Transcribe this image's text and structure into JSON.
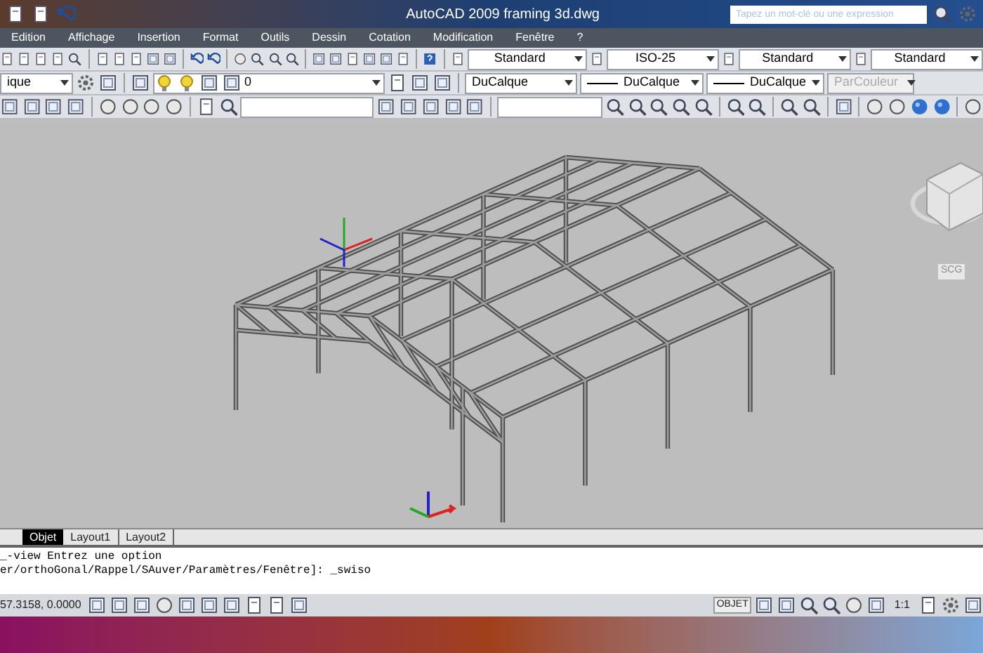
{
  "window": {
    "title": "AutoCAD 2009 framing 3d.dwg",
    "search": {
      "placeholder": "Tapez un mot-clé ou une expression"
    }
  },
  "menu": [
    "Edition",
    "Affichage",
    "Insertion",
    "Format",
    "Outils",
    "Dessin",
    "Cotation",
    "Modification",
    "Fenêtre",
    "?"
  ],
  "style_toolbar": {
    "dropdowns": [
      "Standard",
      "ISO-25",
      "Standard",
      "Standard"
    ]
  },
  "layers_toolbar": {
    "layer_state": "ique",
    "current_layer": "0"
  },
  "properties_toolbar": {
    "color_dropdown": "DuCalque",
    "linetype": "DuCalque",
    "lineweight": "DuCalque",
    "plot_style": {
      "value": "ParCouleur",
      "disabled": true
    }
  },
  "viewport": {
    "ucs_label": "SCG"
  },
  "tabs": [
    {
      "label": "Objet",
      "selected": true
    },
    {
      "label": "Layout1",
      "selected": false
    },
    {
      "label": "Layout2",
      "selected": false
    }
  ],
  "command_lines": [
    "_-view Entrez une option",
    "er/orthoGonal/Rappel/SAuver/Paramètres/Fenêtre]: _swiso"
  ],
  "status_bar": {
    "coordinates": "57.3158, 0.0000",
    "space": "OBJET",
    "scale": "1:1"
  }
}
